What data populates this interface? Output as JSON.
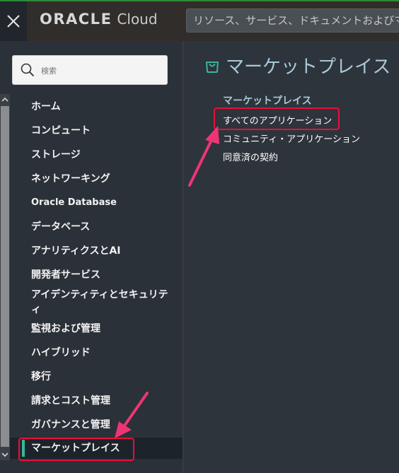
{
  "topbar": {
    "close_icon": "close-icon",
    "logo_oracle": "ORACLE",
    "logo_cloud": "Cloud",
    "search_placeholder": "リソース、サービス、ドキュメントおよびマー"
  },
  "sidebar": {
    "search_placeholder": "検索",
    "search_icon": "search-icon",
    "items": [
      {
        "label": "ホーム"
      },
      {
        "label": "コンピュート"
      },
      {
        "label": "ストレージ"
      },
      {
        "label": "ネットワーキング"
      },
      {
        "label": "Oracle Database"
      },
      {
        "label": "データベース"
      },
      {
        "label": "アナリティクスとAI"
      },
      {
        "label": "開発者サービス"
      },
      {
        "label": "アイデンティティとセキュリティ"
      },
      {
        "label": "監視および管理"
      },
      {
        "label": "ハイブリッド"
      },
      {
        "label": "移行"
      },
      {
        "label": "請求とコスト管理"
      },
      {
        "label": "ガバナンスと管理"
      },
      {
        "label": "マーケットプレイス",
        "active": true
      }
    ]
  },
  "panel": {
    "title": "マーケットプレイス",
    "title_icon": "shopping-bag-icon",
    "section_heading": "マーケットプレイス",
    "links": [
      {
        "label": "すべてのアプリケーション"
      },
      {
        "label": "コミュニティ・アプリケーション"
      },
      {
        "label": "同意済の契約"
      }
    ]
  },
  "colors": {
    "accent_green": "#3bb59b",
    "annotation_red": "#e8103a",
    "arrow_pink": "#ee3574",
    "heading_blue": "#a9c9d8"
  }
}
